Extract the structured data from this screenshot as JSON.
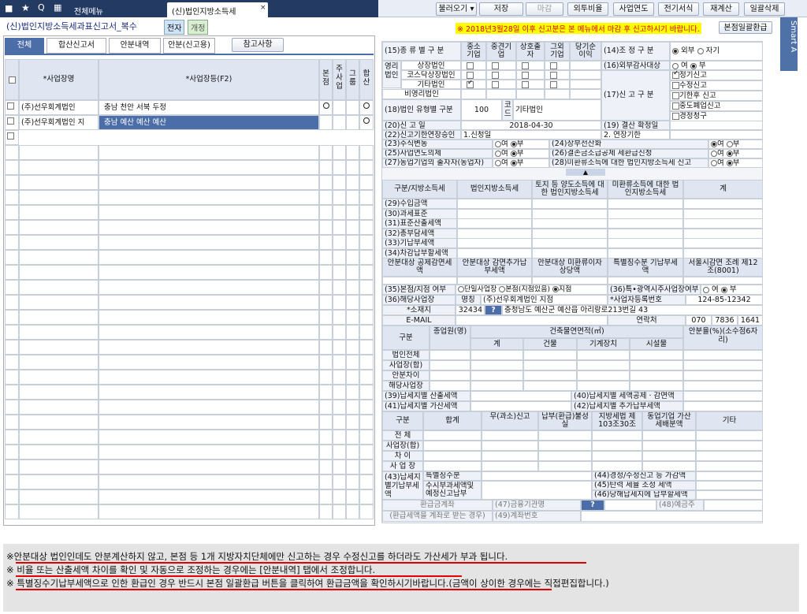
{
  "nav": {
    "menu": "전체메뉴",
    "active_tab": "(신)법인지방소득세"
  },
  "toolbar": {
    "b1": "불러오기",
    "b2": "저장",
    "b3": "마감",
    "b4": "외투비율",
    "b5": "사업연도",
    "b6": "전기서식",
    "b7": "재계산",
    "b8": "일괄삭제"
  },
  "form": {
    "title": "(신)법인지방소득세과표신고서_복수",
    "badge1": "전자",
    "badge2": "개정",
    "notice": "※ 2018년3월28일 이후 신고분은 본 메뉴에서 마감 후 신고하시기 바랍니다.",
    "refund_button": "본점일괄환급",
    "smart": "Smart A"
  },
  "subtabs": [
    "전체",
    "합산신고서",
    "안분내역",
    "안분(신고용)"
  ],
  "ref_button": "참고사항",
  "left_table": {
    "h_name": "*사업장명",
    "h_addr": "*사업장등(F2)",
    "h_main": "본점",
    "h_owner": "주사업",
    "h_group": "그룹",
    "h_sum": "합산",
    "rows": [
      {
        "name": "(주)선우회계법인",
        "addr": "충남 천안 서북 두정"
      },
      {
        "name": "(주)선우회계법인 지",
        "addr": "충남 예산 예산 예산"
      }
    ]
  },
  "r": {
    "l15": "(15)종 류 별 구 분",
    "c_small": "중소기업",
    "c_mid": "중견기업",
    "c_mutual": "상호출자",
    "c_other": "그외기업",
    "c_prof": "당기순이익",
    "l_prof_corp": "영리법인",
    "l_listed": "상장법인",
    "l_kosdaq": "코스닥상장법인",
    "l_etc": "기타법인",
    "l_nonprof": "비영리법인",
    "l14": "(14)조 정 구 분",
    "o_ext": "외부",
    "o_self": "자기",
    "l16": "(16)외부감사대상",
    "o_yes": "여",
    "o_no": "부",
    "l17": "(17)신 고 구 분",
    "k1": "정기신고",
    "k2": "수정신고",
    "k3": "기한후 신고",
    "k4": "중도폐업신고",
    "k5": "경정청구",
    "l18": "(18)법인 유형별 구분",
    "l18_val": "100",
    "l18_code": "코드",
    "l18_name": "기타법인",
    "l20": "(20)신 고 일",
    "l20_val": "2018-04-30",
    "l19": "(19) 결산 확정일",
    "l22": "(22)신고기한연장승인",
    "l22a": "1.신청일",
    "l22b": "2. 연장기한",
    "l23": "(23)주식변동",
    "l24": "(24)장부전산화",
    "l25": "(25)사업연도의제",
    "l26": "(26)결손금소급공제 세환급신청",
    "l27": "(27)동업기업의 출자자(동업자)",
    "l28": "(28)미환류소득에 대한 법인지방소득세 신고",
    "t_h1": "구분/지방소득세",
    "t_h2": "법인지방소득세",
    "t_h3": "토지 등 양도소득에 대한 법인지방소득세",
    "t_h4": "미환류소득에 대한 법인지방소득세",
    "t_h5": "계",
    "rows1": [
      "(29)수입금액",
      "(30)과세표준",
      "(31)표준산출세액",
      "(32)총부담세액",
      "(33)기납부세액",
      "(34)차감납부할세액"
    ],
    "t2_h1": "안분대상 공제감면세액",
    "t2_h2": "안분대상 감면추가납부세액",
    "t2_h3": "안분대상 미환류이자상당액",
    "t2_h4": "특별징수분 기납부세액",
    "t2_h5": "서울시감면 조례 제12조(8001)",
    "l35": "(35)본점/지점 여부",
    "l35a": "단일사업장",
    "l35b": "본점(지점있음)",
    "l35c": "지점",
    "l36b": "(36)특•광역시주사업장여부",
    "l36": "(36)해당사업장",
    "lbl_name": "명칭",
    "val_name": "(주)선우회계법인 지점",
    "lbl_reg": "*사업자등록번호",
    "val_reg": "124-85-12342",
    "lbl_addr": "*소재지",
    "val_zip": "32434",
    "val_addr": "충청남도 예산군 예산읍 아리랑로213번길 43",
    "lbl_email": "E-MAIL",
    "lbl_tel": "연락처",
    "tel1": "070",
    "tel2": "7836",
    "tel3": "1641",
    "t3_h1": "구분",
    "t3_h2": "종업원(명)",
    "t3_h3": "건축물연면적(㎡)",
    "t3_h3a": "계",
    "t3_h3b": "건물",
    "t3_h3c": "기계장치",
    "t3_h3d": "시설물",
    "t3_h4": "안분율(%)(소수점6자리)",
    "rows3": [
      "법인전체",
      "사업장(합)",
      "안분차이",
      "해당사업장"
    ],
    "l39": "(39)납세지별 산출세액",
    "l40": "(40)납세지별 세액공제 · 감면액",
    "l41": "(41)납세지별 가산세액",
    "l42": "(42)납세지별 추가납부세액",
    "t4_h1": "구분",
    "t4_h2": "합계",
    "t4_h3": "무(과소)신고",
    "t4_h4": "납부(환급)불성실",
    "t4_h5": "지방세법 제103조30조",
    "t4_h6": "동업기업 가산세배분액",
    "t4_h7": "기타",
    "rows4": [
      "전 체",
      "사업장(합)",
      "차 이",
      "사 업 장"
    ],
    "l43": "(43)납세지별기납부세액",
    "l43a": "특별징수분",
    "l43b": "수시부과세액및 예정신고납부",
    "l44": "(44)경정/수정신고 등 가감액",
    "l45": "(45)탄력 세율 조정 세액",
    "l46": "(46)당해납세지에 납부할세액",
    "l_refund": "환급금계좌",
    "l_refund_sub": "(환급세액을 계좌로 받는 경우)",
    "l47": "(47)금융기관명",
    "l48": "(48)예금주",
    "l49": "(49)계좌번호"
  },
  "notes": [
    "※안분대상 법인인데도 안분계산하지 않고, 본점 등 1개 지방자치단체에만 신고하는 경우 수정신고를 하더라도 가산세가 부과 됩니다.",
    "※ 비율 또는 산출세액 차이를 확인 및 자동으로 조정하는 경우에는 [안분내역] 탭에서 조정합니다.",
    "※ 특별징수기납부세액으로 인한 환급인 경우 반드시 본점 일괄환급 버튼을 클릭하여 환급금액을 확인하시기바랍니다.(금액이 상이한 경우에는 직접편집합니다.)"
  ],
  "colors": {
    "nav": "#233a63",
    "accent": "#e00000",
    "header": "#dfe6f1"
  }
}
